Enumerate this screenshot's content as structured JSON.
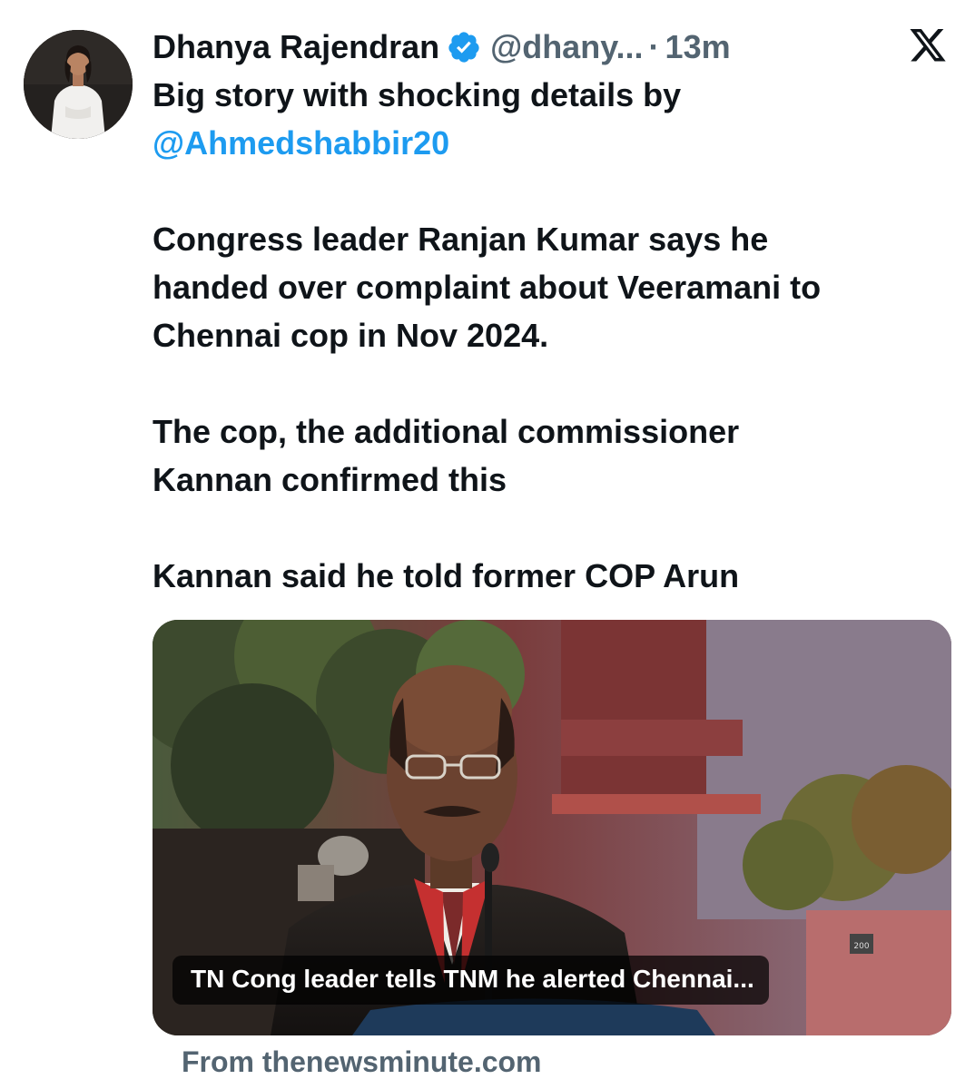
{
  "tweet": {
    "author_name": "Dhanya Rajendran",
    "handle": "@dhany...",
    "separator": "·",
    "time": "13m",
    "avatar_icon": "profile-photo",
    "verified_icon": "verified-badge-icon",
    "platform_icon": "x-logo-icon",
    "body": {
      "line1": "Big story with shocking details by",
      "mention": "@Ahmedshabbir20",
      "para2_line1": "Congress leader Ranjan Kumar says he",
      "para2_line2": "handed over complaint about Veeramani to",
      "para2_line3": "Chennai cop in Nov 2024.",
      "para3_line1": "The cop, the additional commissioner",
      "para3_line2": "Kannan confirmed this",
      "para4_line1": "Kannan said he told former COP Arun"
    }
  },
  "link_card": {
    "title": "TN Cong leader tells TNM he alerted Chennai...",
    "source": "From thenewsminute.com",
    "podium_text": "200"
  },
  "colors": {
    "text": "#0f1419",
    "secondary": "#536471",
    "link": "#1d9bf0",
    "verified": "#1d9bf0"
  }
}
